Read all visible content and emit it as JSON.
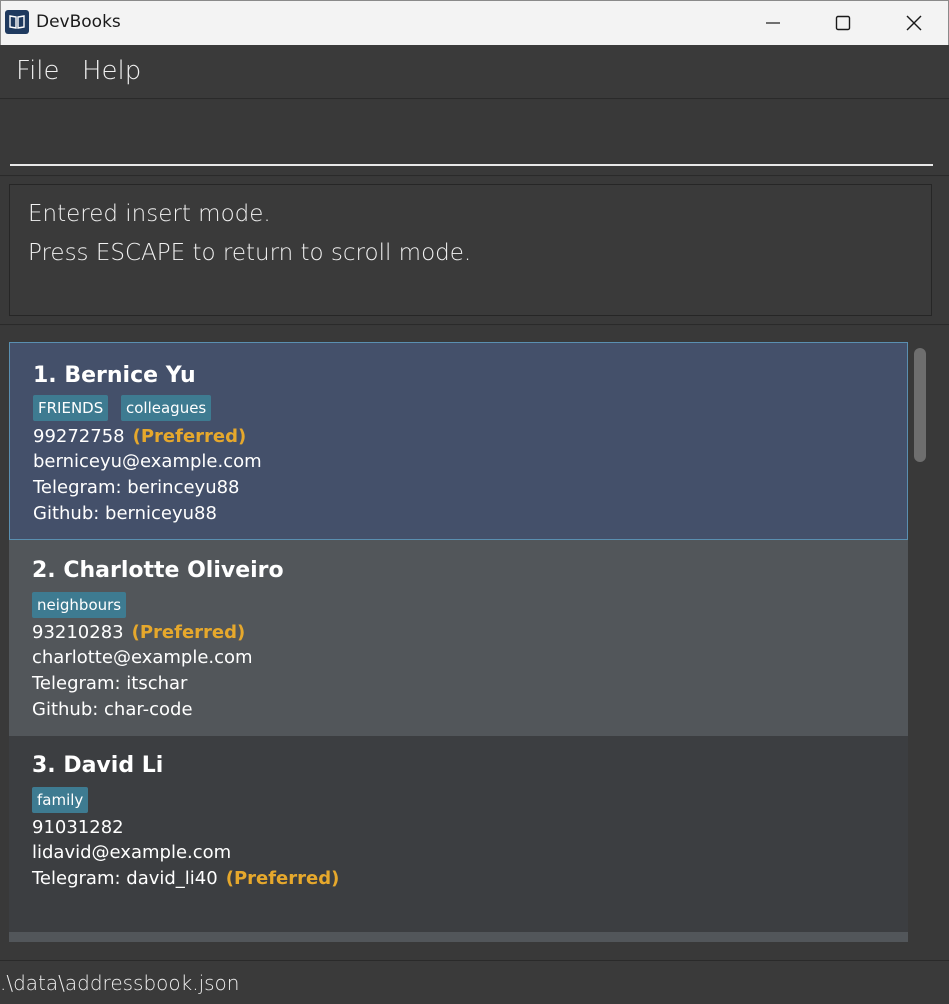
{
  "window": {
    "title": "DevBooks",
    "icon": "book-icon",
    "controls": [
      "minimize-icon",
      "maximize-icon",
      "close-icon"
    ]
  },
  "menu": {
    "file": "File",
    "help": "Help"
  },
  "command": {
    "value": "",
    "placeholder": ""
  },
  "result": {
    "line1": "Entered insert mode.",
    "line2": "Press ESCAPE to return to scroll mode."
  },
  "contacts": [
    {
      "index_name": "1. Bernice Yu",
      "tags": [
        "FRIENDS",
        "colleagues"
      ],
      "phone": "99272758",
      "phone_note": "(Preferred)",
      "email": "berniceyu@example.com",
      "telegram": "Telegram: berinceyu88",
      "github": "Github: berniceyu88",
      "selected": true
    },
    {
      "index_name": "2. Charlotte Oliveiro",
      "tags": [
        "neighbours"
      ],
      "phone": "93210283",
      "phone_note": "(Preferred)",
      "email": "charlotte@example.com",
      "telegram": "Telegram: itschar",
      "github": "Github: char-code",
      "selected": false
    },
    {
      "index_name": "3. David Li",
      "tags": [
        "family"
      ],
      "phone": "91031282",
      "email": "lidavid@example.com",
      "telegram": "Telegram: david_li40",
      "telegram_note": "(Preferred)",
      "selected": false
    }
  ],
  "status": {
    "path": ".\\data\\addressbook.json"
  },
  "colors": {
    "background": "#383838",
    "selected_card": "#44506a",
    "alt_card": "#52565a",
    "tag": "#3e7b91",
    "preferred": "#e6a82c"
  }
}
